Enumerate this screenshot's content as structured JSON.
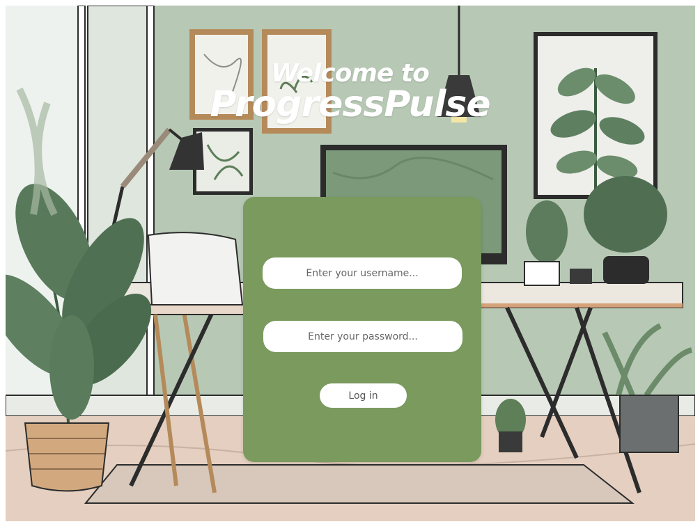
{
  "header": {
    "welcome_line": "Welcome to",
    "app_name": "ProgressPulse"
  },
  "login_form": {
    "username_placeholder": "Enter your username...",
    "password_placeholder": "Enter your password...",
    "login_label": "Log in"
  },
  "colors": {
    "card_background": "#7a9a5e",
    "wall": "#b9c9b6",
    "field_background": "#ffffff"
  },
  "background": {
    "scene": "illustrated home office with plants, desk, monitor, lamps and framed pictures"
  }
}
